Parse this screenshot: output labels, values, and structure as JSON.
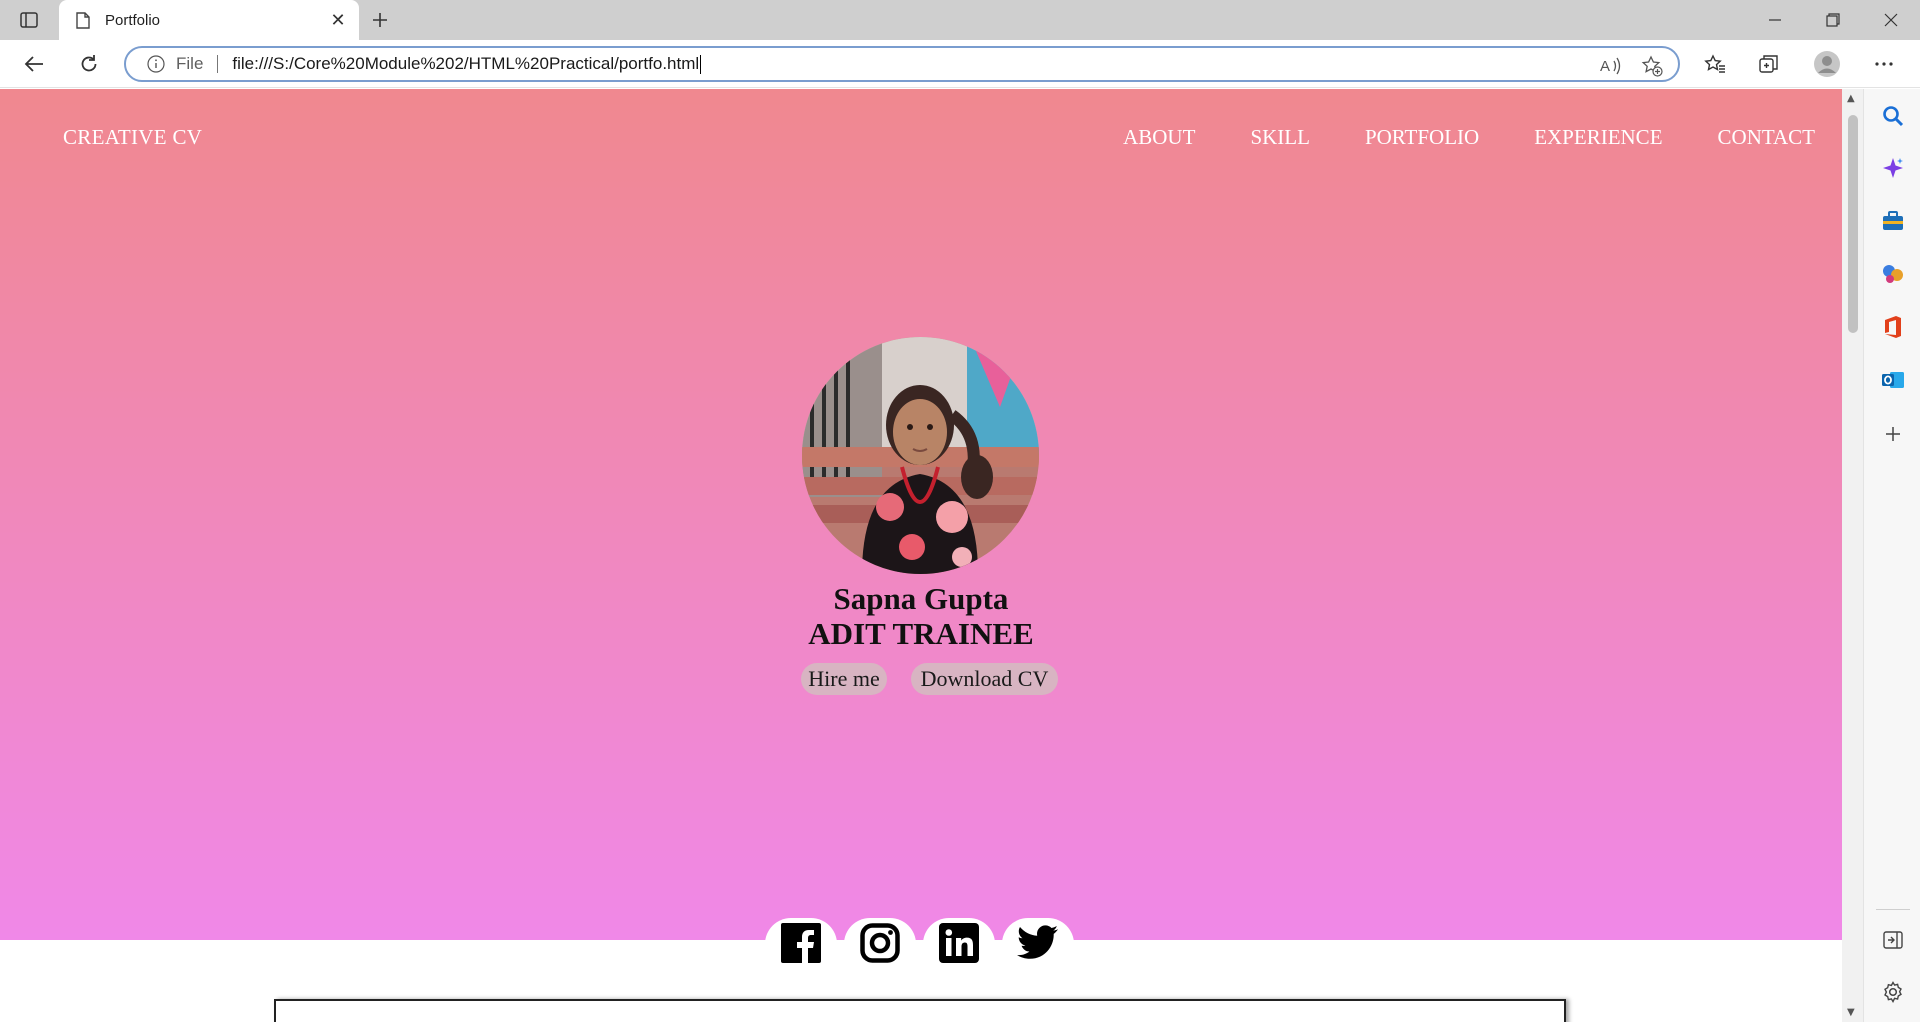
{
  "browser": {
    "tab_title": "Portfolio",
    "address_scheme_label": "File",
    "url": "file:///S:/Core%20Module%202/HTML%20Practical/portfo.html"
  },
  "page": {
    "nav": {
      "brand": "CREATIVE CV",
      "links": [
        "ABOUT",
        "SKILL",
        "PORTFOLIO",
        "EXPERIENCE",
        "CONTACT"
      ]
    },
    "profile": {
      "name": "Sapna Gupta",
      "role": "ADIT TRAINEE"
    },
    "buttons": {
      "hire": "Hire me",
      "download": "Download CV"
    },
    "social_icons": [
      "facebook-icon",
      "instagram-icon",
      "linkedin-icon",
      "twitter-icon"
    ],
    "colors": {
      "gradient_top": "#f0888f",
      "gradient_bottom": "#f088e8",
      "button_bg": "#d8b4c2"
    }
  }
}
